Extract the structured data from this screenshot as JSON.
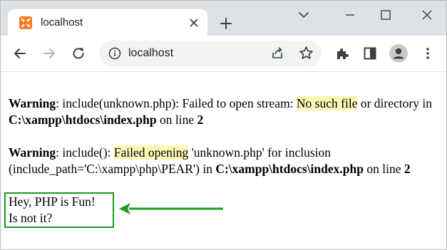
{
  "tab": {
    "title": "localhost"
  },
  "address_bar": {
    "url": "localhost"
  },
  "warnings": [
    {
      "label": "Warning",
      "text1": ": include(unknown.php): Failed to open stream: ",
      "highlight": "No such file",
      "text2": " or directory in ",
      "path": "C:\\xampp\\htdocs\\index.php",
      "text3": " on line ",
      "line": "2"
    },
    {
      "label": "Warning",
      "text1": ": include(): ",
      "highlight": "Failed opening",
      "text2": " 'unknown.php' for inclusion (include_path='C:\\xampp\\php\\PEAR') in ",
      "path": "C:\\xampp\\htdocs\\index.php",
      "text3": " on line ",
      "line": "2"
    }
  ],
  "output": {
    "line1": "Hey, PHP is Fun!",
    "line2": "Is not it?"
  },
  "colors": {
    "highlight": "#fdf7b5",
    "annotation_green": "#1c9b1c",
    "favicon_orange": "#fb7a24"
  },
  "icons": [
    "xampp-favicon",
    "close-icon",
    "plus-icon",
    "chevron-down-icon",
    "minimize-icon",
    "maximize-icon",
    "back-arrow-icon",
    "forward-arrow-icon",
    "reload-icon",
    "info-icon",
    "share-icon",
    "star-icon",
    "extensions-icon",
    "sidepanel-icon",
    "profile-icon",
    "kebab-menu-icon",
    "arrow-left-icon"
  ]
}
